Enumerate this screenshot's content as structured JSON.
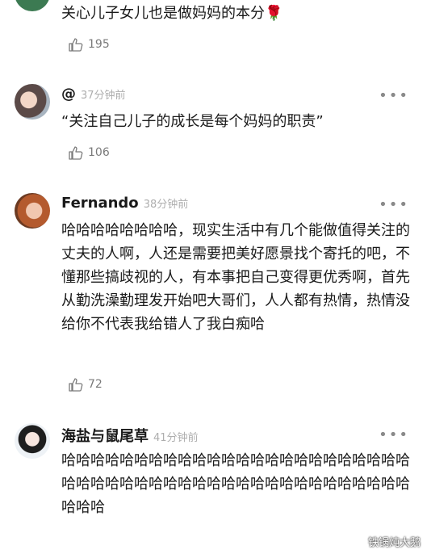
{
  "comments": [
    {
      "author": "",
      "time": "",
      "text": "关心儿子女儿也是做妈妈的本分",
      "emoji": "🌹",
      "likes": "195"
    },
    {
      "author": "@",
      "time": "37分钟前",
      "text": "“关注自己儿子的成长是每个妈妈的职责”",
      "likes": "106"
    },
    {
      "author": "Fernando",
      "time": "38分钟前",
      "text": "哈哈哈哈哈哈哈哈，现实生活中有几个能做值得关注的丈夫的人啊，人还是需要把美好愿景找个寄托的吧，不懂那些搞歧视的人，有本事把自己变得更优秀啊，首先从勤洗澡勤理发开始吧大哥们，人人都有热情，热情没给你不代表我给错人了我白痴哈",
      "likes": "72"
    },
    {
      "author": "海盐与鼠尾草",
      "time": "41分钟前",
      "text": "哈哈哈哈哈哈哈哈哈哈哈哈哈哈哈哈哈哈哈哈哈哈哈哈哈哈哈哈哈哈哈哈哈哈哈哈哈哈哈哈哈哈哈哈哈哈哈哈哈哈哈"
    }
  ],
  "more_icon": "more-dots-icon",
  "like_icon": "thumbs-up-icon",
  "watermark": "铁锅炖大鹅"
}
